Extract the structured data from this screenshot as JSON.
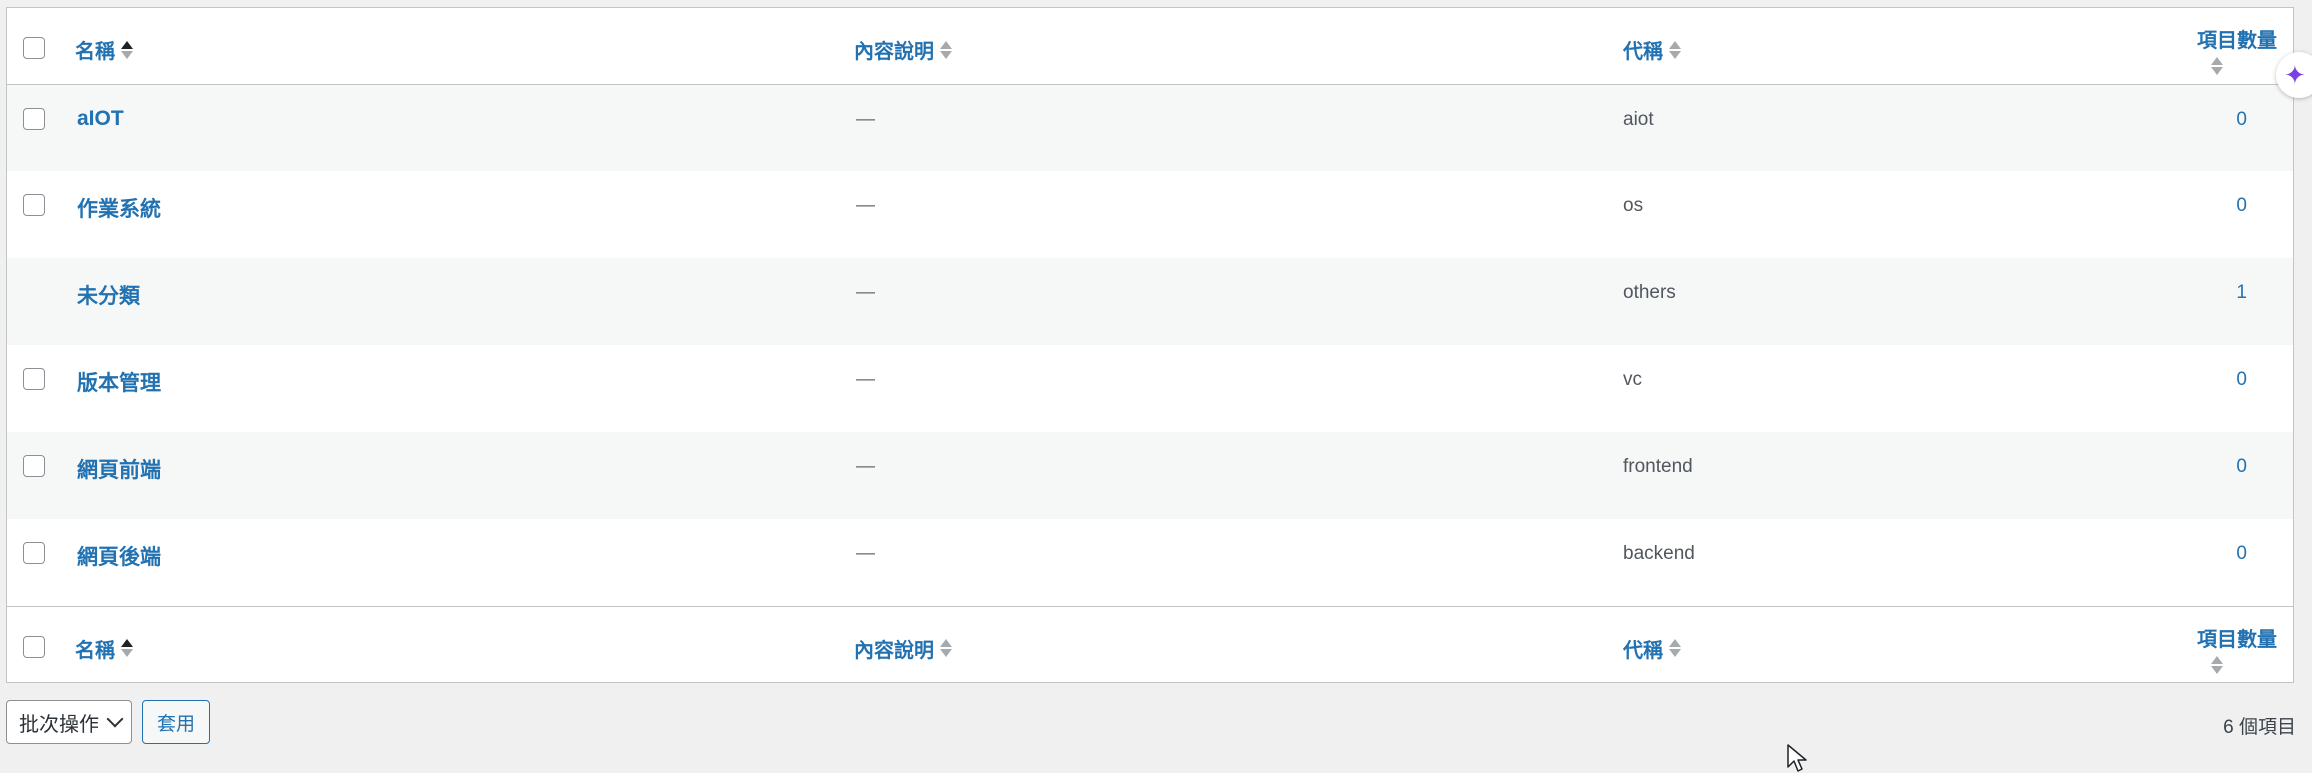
{
  "columns": {
    "name": "名稱",
    "description": "內容說明",
    "slug": "代稱",
    "count": "項目數量"
  },
  "rows": [
    {
      "name": "aIOT",
      "description": "—",
      "slug": "aiot",
      "count": "0",
      "has_checkbox": true
    },
    {
      "name": "作業系統",
      "description": "—",
      "slug": "os",
      "count": "0",
      "has_checkbox": true
    },
    {
      "name": "未分類",
      "description": "—",
      "slug": "others",
      "count": "1",
      "has_checkbox": false
    },
    {
      "name": "版本管理",
      "description": "—",
      "slug": "vc",
      "count": "0",
      "has_checkbox": true
    },
    {
      "name": "網頁前端",
      "description": "—",
      "slug": "frontend",
      "count": "0",
      "has_checkbox": true
    },
    {
      "name": "網頁後端",
      "description": "—",
      "slug": "backend",
      "count": "0",
      "has_checkbox": true
    }
  ],
  "bulk_actions": {
    "selected": "批次操作",
    "apply_label": "套用"
  },
  "items_count": "6 個項目",
  "colors": {
    "link": "#2271b1",
    "alt_row": "#f6f7f7",
    "page_bg": "#f0f0f1",
    "ai_sparkle": "#7b3fe4"
  },
  "icons": {
    "sort": "sort-arrows-icon",
    "chevron": "chevron-down-icon",
    "ai": "sparkle-icon",
    "cursor": "mouse-cursor-icon"
  }
}
